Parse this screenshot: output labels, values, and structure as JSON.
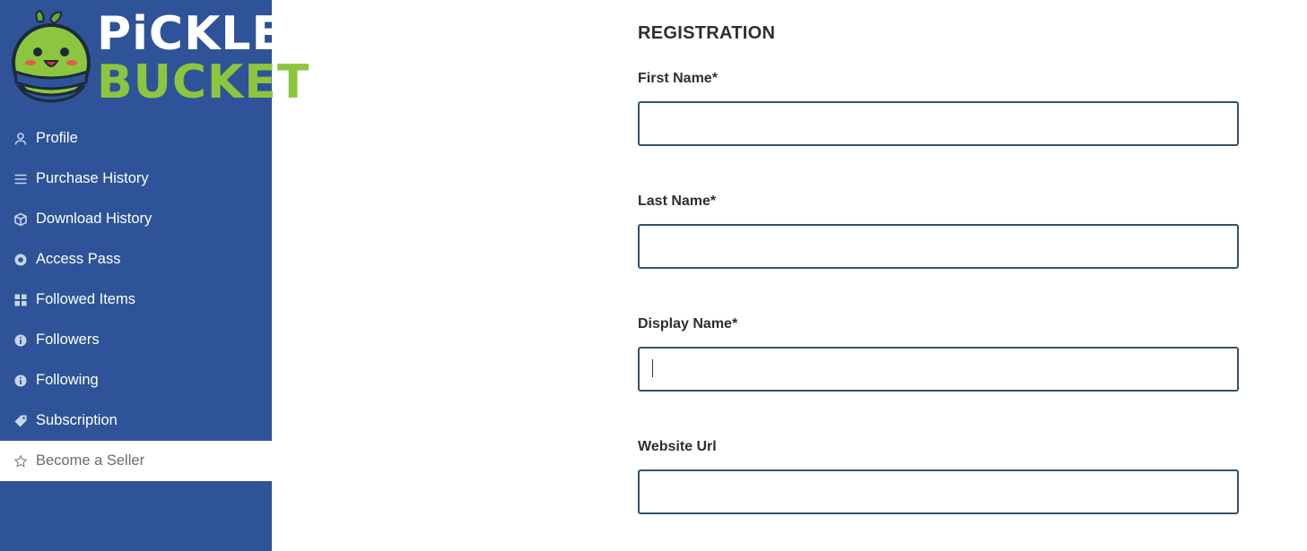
{
  "logo": {
    "line1": "PiCKLES",
    "line2": "BUCKET",
    "brand_green": "#8cc63f"
  },
  "sidebar": {
    "bg": "#2e5399",
    "items": [
      {
        "label": "Profile",
        "icon": "user-icon"
      },
      {
        "label": "Purchase History",
        "icon": "menu-lines-icon"
      },
      {
        "label": "Download History",
        "icon": "box-icon"
      },
      {
        "label": "Access Pass",
        "icon": "circle-dot-icon"
      },
      {
        "label": "Followed Items",
        "icon": "grid-icon"
      },
      {
        "label": "Followers",
        "icon": "info-icon"
      },
      {
        "label": "Following",
        "icon": "info-icon"
      },
      {
        "label": "Subscription",
        "icon": "tag-icon"
      },
      {
        "label": "Become a Seller",
        "icon": "star-icon",
        "active": true
      }
    ]
  },
  "form": {
    "title": "REGISTRATION",
    "fields": [
      {
        "label": "First Name*",
        "value": "",
        "placeholder": ""
      },
      {
        "label": "Last Name*",
        "value": "",
        "placeholder": ""
      },
      {
        "label": "Display Name*",
        "value": "",
        "placeholder": "",
        "focused": true
      },
      {
        "label": "Website Url",
        "value": "",
        "placeholder": ""
      }
    ]
  }
}
